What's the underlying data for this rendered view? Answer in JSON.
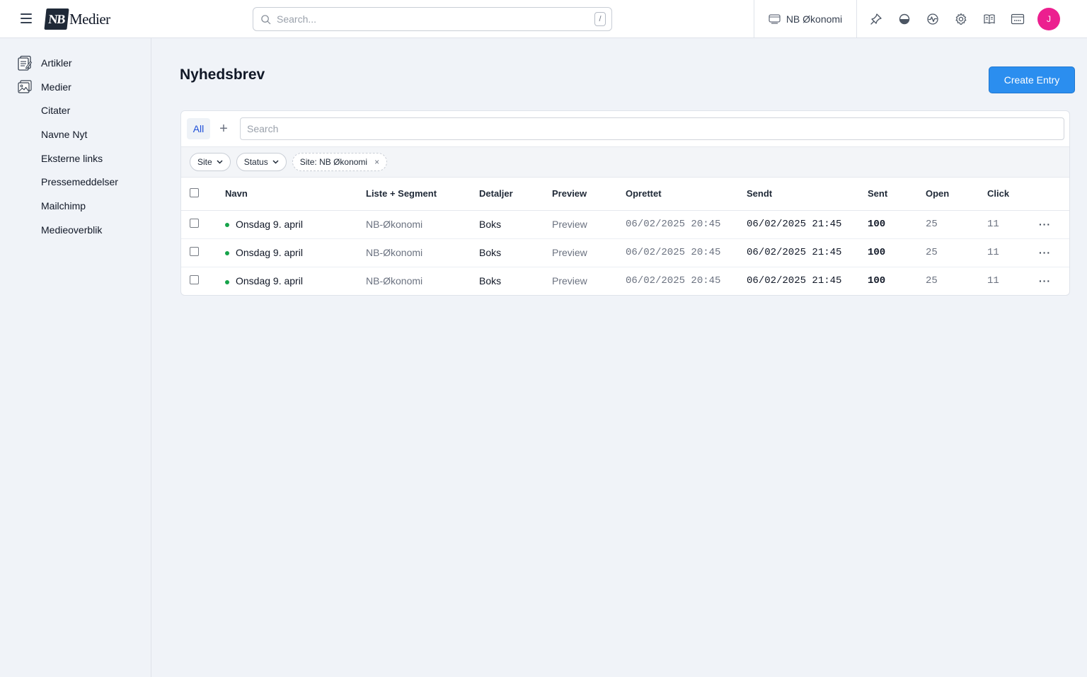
{
  "header": {
    "logo_mark": "NB",
    "logo_text": "Medier",
    "search_placeholder": "Search...",
    "search_shortcut": "/",
    "site_name": "NB Økonomi",
    "avatar_initial": "J"
  },
  "sidebar": {
    "items": [
      {
        "label": "Artikler",
        "icon": "articles-icon"
      },
      {
        "label": "Medier",
        "icon": "media-icon"
      },
      {
        "label": "Citater"
      },
      {
        "label": "Navne Nyt"
      },
      {
        "label": "Eksterne links"
      },
      {
        "label": "Pressemeddelser"
      },
      {
        "label": "Mailchimp"
      },
      {
        "label": "Medieoverblik"
      }
    ]
  },
  "main": {
    "title": "Nyhedsbrev",
    "create_label": "Create Entry",
    "tab_all": "All",
    "tab_add": "+",
    "search_placeholder": "Search",
    "filters": {
      "site": "Site",
      "status": "Status",
      "active": "Site: NB Økonomi",
      "remove": "×"
    },
    "columns": [
      "Navn",
      "Liste + Segment",
      "Detaljer",
      "Preview",
      "Oprettet",
      "Sendt",
      "Sent",
      "Open",
      "Click"
    ],
    "rows": [
      {
        "name": "Onsdag 9. april",
        "list": "NB-Økonomi",
        "details": "Boks",
        "preview": "Preview",
        "created": "06/02/2025 20:45",
        "sent_at": "06/02/2025 21:45",
        "sent": "100",
        "open": "25",
        "click": "11",
        "menu": "···"
      },
      {
        "name": "Onsdag 9. april",
        "list": "NB-Økonomi",
        "details": "Boks",
        "preview": "Preview",
        "created": "06/02/2025 20:45",
        "sent_at": "06/02/2025 21:45",
        "sent": "100",
        "open": "25",
        "click": "11",
        "menu": "···"
      },
      {
        "name": "Onsdag 9. april",
        "list": "NB-Økonomi",
        "details": "Boks",
        "preview": "Preview",
        "created": "06/02/2025 20:45",
        "sent_at": "06/02/2025 21:45",
        "sent": "100",
        "open": "25",
        "click": "11",
        "menu": "···"
      }
    ]
  },
  "colors": {
    "accent": "#2b8eef",
    "avatar": "#ec1f8f",
    "status_published": "#16a34a",
    "background": "#f0f3f8"
  }
}
